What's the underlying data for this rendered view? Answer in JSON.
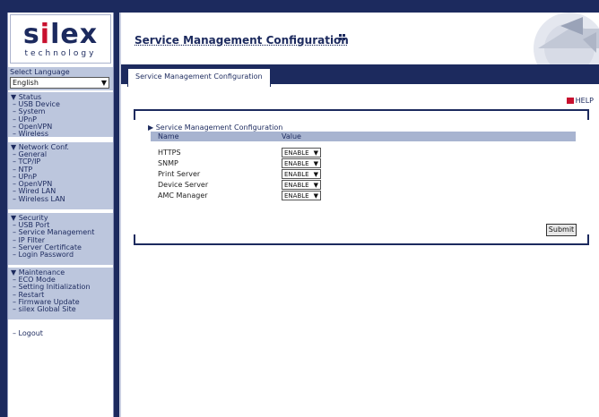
{
  "logo": {
    "word_a": "s",
    "word_i": "i",
    "word_b": "lex",
    "sub": "technology"
  },
  "language": {
    "label": "Select Language",
    "selected": "English"
  },
  "sections": [
    {
      "title": "▼ Status",
      "items": [
        "– USB Device",
        "– System",
        "– UPnP",
        "– OpenVPN",
        "– Wireless"
      ]
    },
    {
      "title": "▼ Network Conf.",
      "items": [
        "– General",
        "– TCP/IP",
        "– NTP",
        "– UPnP",
        "– OpenVPN",
        "– Wired LAN",
        "– Wireless LAN"
      ]
    },
    {
      "title": "▼ Security",
      "items": [
        "– USB Port",
        "– Service Management",
        "– IP Filter",
        "– Server Certificate",
        "– Login Password"
      ]
    },
    {
      "title": "▼ Maintenance",
      "items": [
        "– ECO Mode",
        "– Setting Initialization",
        "– Restart",
        "– Firmware Update",
        "– silex Global Site"
      ]
    }
  ],
  "logout": "– Logout",
  "header": {
    "title": "Service Management Configuration"
  },
  "tab": {
    "label": "Service Management Configuration"
  },
  "help": "HELP",
  "panel": {
    "title": "▶ Service Management Configuration",
    "col_name": "Name",
    "col_value": "Value",
    "rows": [
      {
        "name": "HTTPS",
        "value": "ENABLE"
      },
      {
        "name": "SNMP",
        "value": "ENABLE"
      },
      {
        "name": "Print Server",
        "value": "ENABLE"
      },
      {
        "name": "Device Server",
        "value": "ENABLE"
      },
      {
        "name": "AMC Manager",
        "value": "ENABLE"
      }
    ]
  },
  "submit": "Submit",
  "colors": {
    "navy": "#1c2a5e",
    "sidebar_block": "#bcc6dd",
    "accent_red": "#c8102e"
  }
}
